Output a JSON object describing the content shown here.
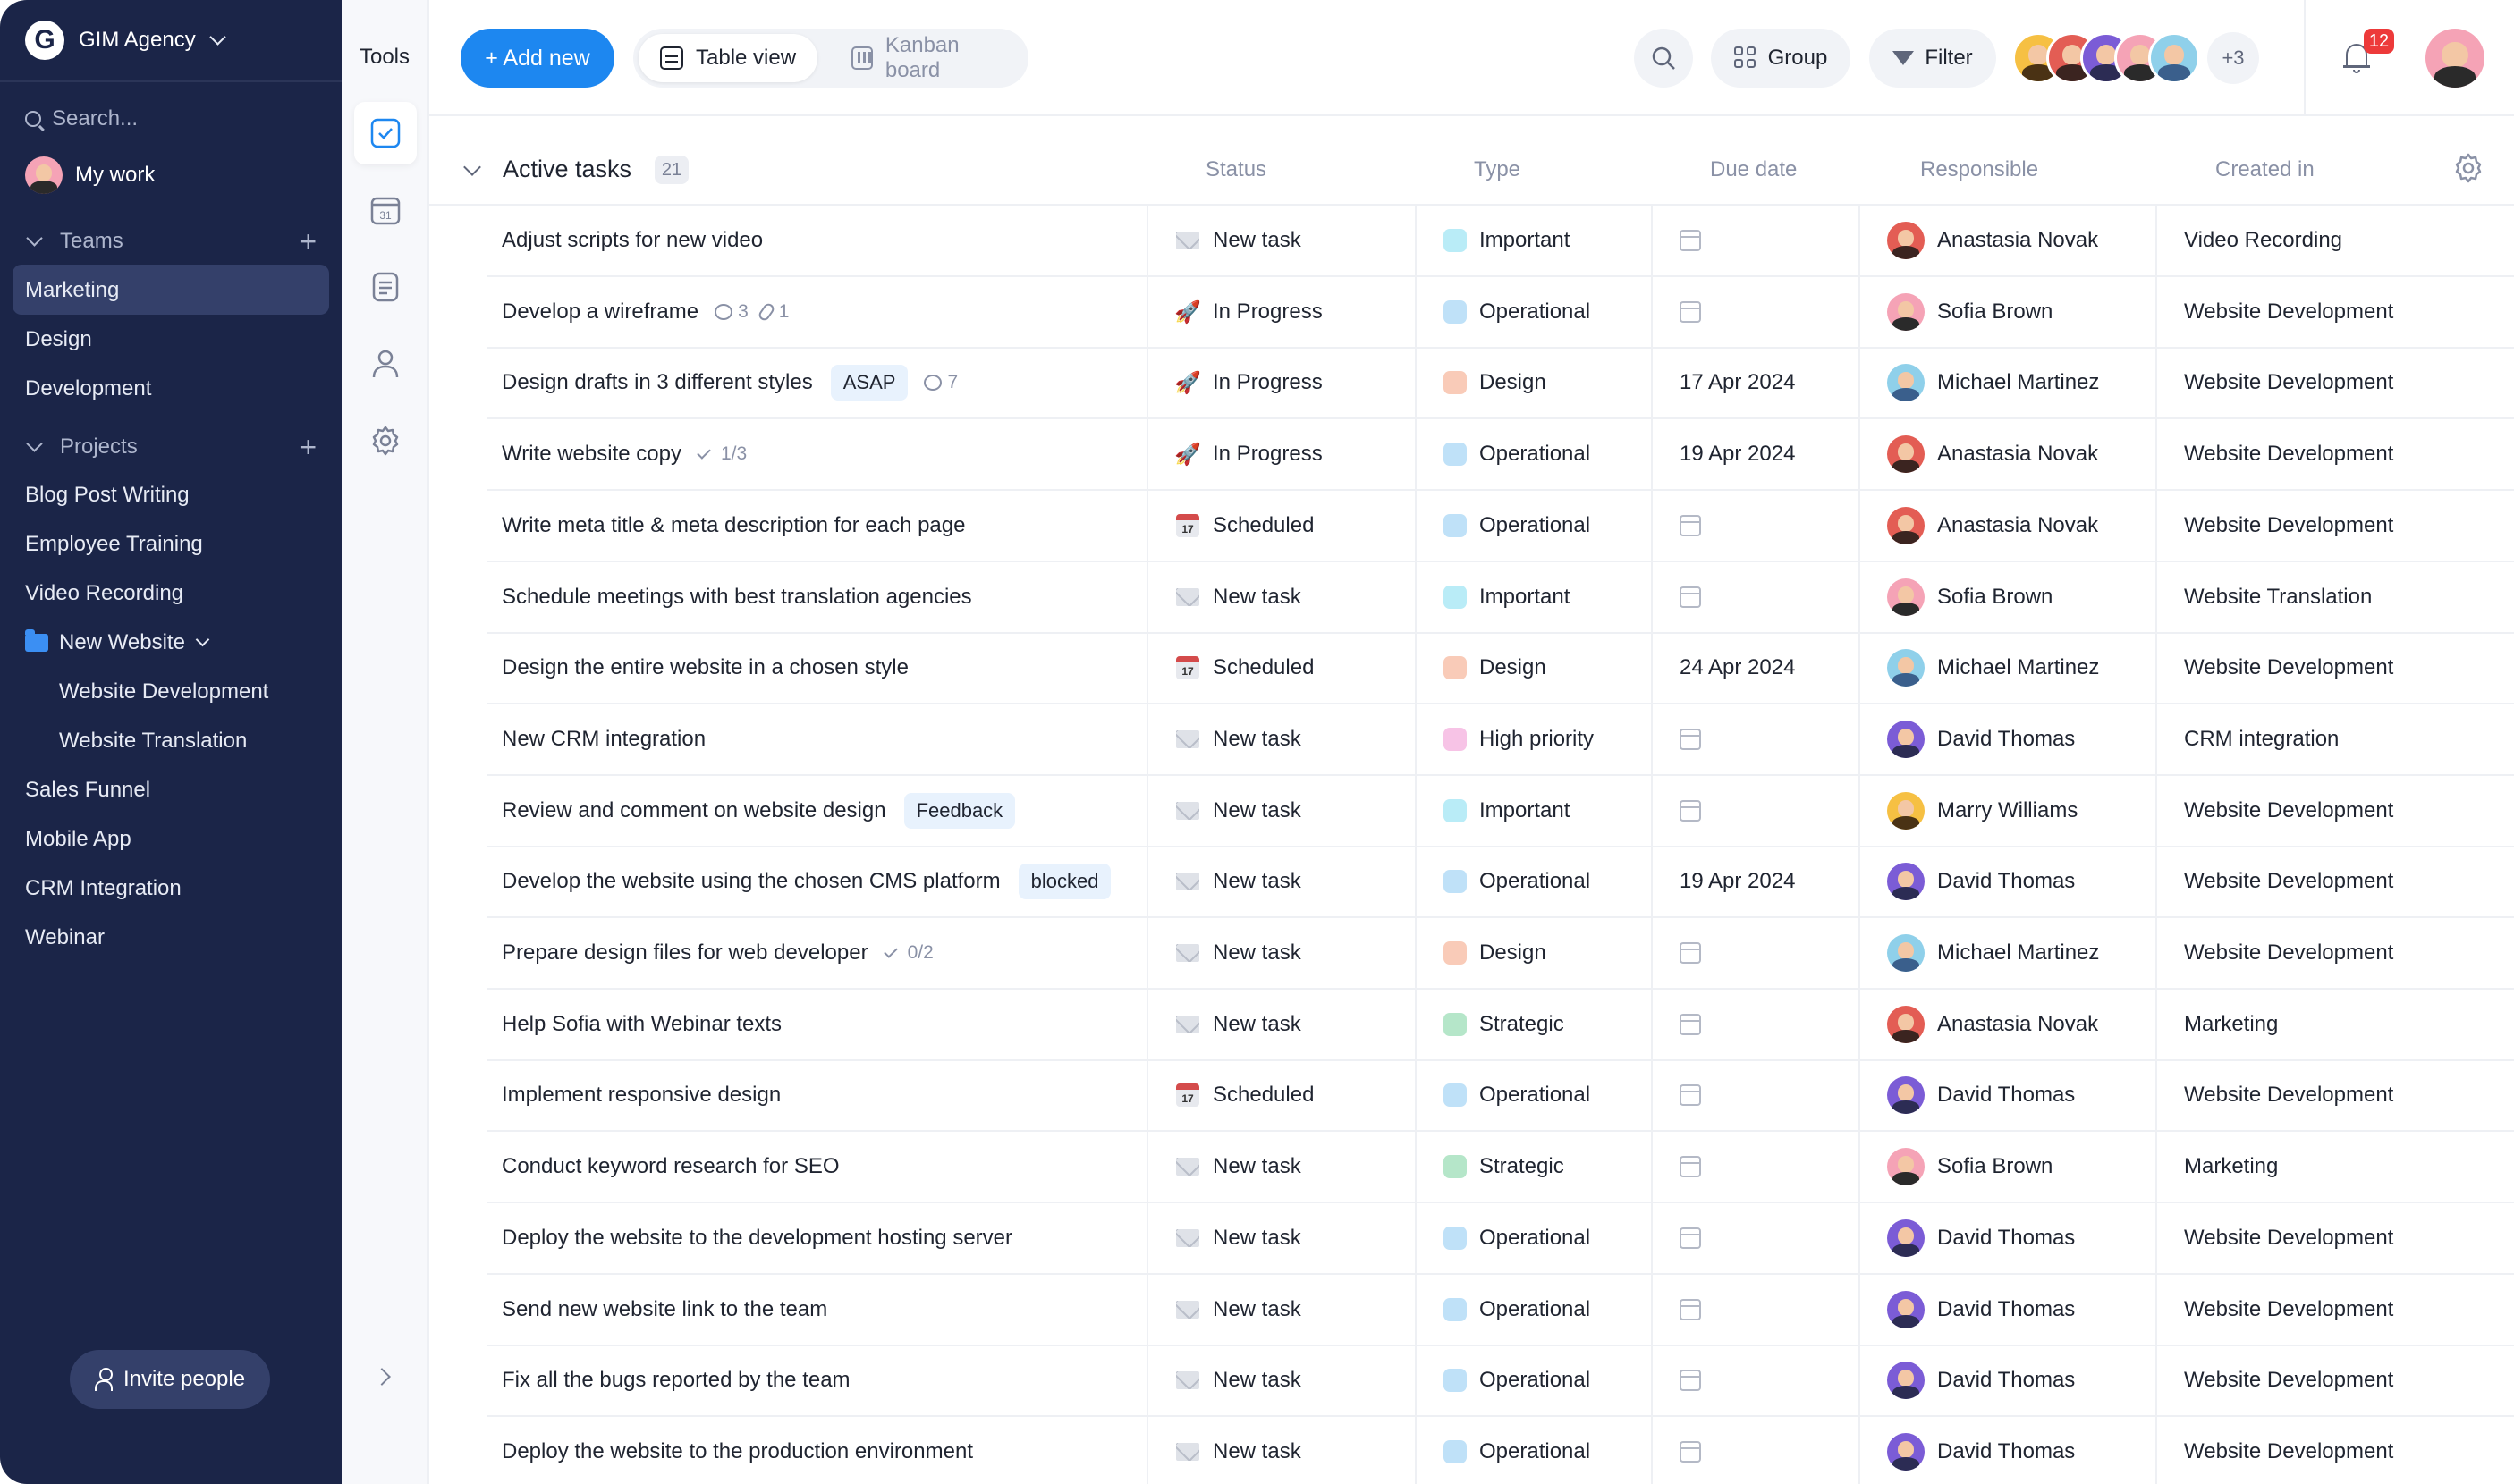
{
  "sidebar": {
    "workspace": "GIM Agency",
    "logo_letter": "G",
    "search_placeholder": "Search...",
    "my_work": "My work",
    "teams_label": "Teams",
    "teams": [
      "Marketing",
      "Design",
      "Development"
    ],
    "active_team": "Marketing",
    "projects_label": "Projects",
    "projects": [
      "Blog Post Writing",
      "Employee Training",
      "Video Recording"
    ],
    "folder": "New Website",
    "folder_children": [
      "Website Development",
      "Website Translation"
    ],
    "projects_after": [
      "Sales Funnel",
      "Mobile App",
      "CRM Integration",
      "Webinar"
    ],
    "invite": "Invite people"
  },
  "tools": {
    "title": "Tools",
    "calendar_day": "31"
  },
  "topbar": {
    "add_new": "+ Add new",
    "views": [
      "Table view",
      "Kanban board"
    ],
    "active_view": "Table view",
    "group": "Group",
    "filter": "Filter",
    "more_members": "+3",
    "notifications": "12"
  },
  "table": {
    "group_title": "Active tasks",
    "count": "21",
    "columns": [
      "Status",
      "Type",
      "Due date",
      "Responsible",
      "Created in"
    ],
    "rows": [
      {
        "task": "Adjust scripts for new video",
        "status": "New task",
        "status_icon": "envelope",
        "type": "Important",
        "type_color": "#b9ecf7",
        "due": "",
        "responsible": "Anastasia Novak",
        "avatar": "red",
        "created_in": "Video Recording"
      },
      {
        "task": "Develop a wireframe",
        "comments": "3",
        "attachments": "1",
        "status": "In Progress",
        "status_icon": "rocket",
        "type": "Operational",
        "type_color": "#bfe1f8",
        "due": "",
        "responsible": "Sofia Brown",
        "avatar": "pink",
        "created_in": "Website Development"
      },
      {
        "task": "Design drafts in 3 different styles",
        "tag": "ASAP",
        "comments": "7",
        "status": "In Progress",
        "status_icon": "rocket",
        "type": "Design",
        "type_color": "#f9cbb8",
        "due": "17 Apr 2024",
        "responsible": "Michael Martinez",
        "avatar": "blue",
        "created_in": "Website Development"
      },
      {
        "task": "Write website copy",
        "checklist": "1/3",
        "status": "In Progress",
        "status_icon": "rocket",
        "type": "Operational",
        "type_color": "#bfe1f8",
        "due": "19 Apr 2024",
        "responsible": "Anastasia Novak",
        "avatar": "red",
        "created_in": "Website Development"
      },
      {
        "task": "Write meta title & meta description for each page",
        "status": "Scheduled",
        "status_icon": "calendar",
        "type": "Operational",
        "type_color": "#bfe1f8",
        "due": "",
        "responsible": "Anastasia Novak",
        "avatar": "red",
        "created_in": "Website Development"
      },
      {
        "task": "Schedule meetings with best translation agencies",
        "status": "New task",
        "status_icon": "envelope",
        "type": "Important",
        "type_color": "#b9ecf7",
        "due": "",
        "responsible": "Sofia Brown",
        "avatar": "pink",
        "created_in": "Website Translation"
      },
      {
        "task": "Design the entire website in a chosen style",
        "status": "Scheduled",
        "status_icon": "calendar",
        "type": "Design",
        "type_color": "#f9cbb8",
        "due": "24 Apr 2024",
        "responsible": "Michael Martinez",
        "avatar": "blue",
        "created_in": "Website Development"
      },
      {
        "task": "New CRM integration",
        "status": "New task",
        "status_icon": "envelope",
        "type": "High priority",
        "type_color": "#f7c3e6",
        "due": "",
        "responsible": "David Thomas",
        "avatar": "purple",
        "created_in": "CRM integration"
      },
      {
        "task": "Review and comment on website design",
        "tag": "Feedback",
        "status": "New task",
        "status_icon": "envelope",
        "type": "Important",
        "type_color": "#b9ecf7",
        "due": "",
        "responsible": "Marry Williams",
        "avatar": "yellow",
        "created_in": "Website Development"
      },
      {
        "task": "Develop the website using the chosen CMS platform",
        "tag": "blocked",
        "status": "New task",
        "status_icon": "envelope",
        "type": "Operational",
        "type_color": "#bfe1f8",
        "due": "19 Apr 2024",
        "responsible": "David Thomas",
        "avatar": "purple",
        "created_in": "Website Development"
      },
      {
        "task": "Prepare design files for web developer",
        "checklist": "0/2",
        "status": "New task",
        "status_icon": "envelope",
        "type": "Design",
        "type_color": "#f9cbb8",
        "due": "",
        "responsible": "Michael Martinez",
        "avatar": "blue",
        "created_in": "Website Development"
      },
      {
        "task": "Help Sofia with Webinar texts",
        "status": "New task",
        "status_icon": "envelope",
        "type": "Strategic",
        "type_color": "#b5e6c9",
        "due": "",
        "responsible": "Anastasia Novak",
        "avatar": "red",
        "created_in": "Marketing"
      },
      {
        "task": "Implement responsive design",
        "status": "Scheduled",
        "status_icon": "calendar",
        "type": "Operational",
        "type_color": "#bfe1f8",
        "due": "",
        "responsible": "David Thomas",
        "avatar": "purple",
        "created_in": "Website Development"
      },
      {
        "task": "Conduct keyword research for SEO",
        "status": "New task",
        "status_icon": "envelope",
        "type": "Strategic",
        "type_color": "#b5e6c9",
        "due": "",
        "responsible": "Sofia Brown",
        "avatar": "pink",
        "created_in": "Marketing"
      },
      {
        "task": "Deploy the website to the development hosting server",
        "status": "New task",
        "status_icon": "envelope",
        "type": "Operational",
        "type_color": "#bfe1f8",
        "due": "",
        "responsible": "David Thomas",
        "avatar": "purple",
        "created_in": "Website Development"
      },
      {
        "task": "Send new website link to the team",
        "status": "New task",
        "status_icon": "envelope",
        "type": "Operational",
        "type_color": "#bfe1f8",
        "due": "",
        "responsible": "David Thomas",
        "avatar": "purple",
        "created_in": "Website Development"
      },
      {
        "task": "Fix all the bugs reported by the team",
        "status": "New task",
        "status_icon": "envelope",
        "type": "Operational",
        "type_color": "#bfe1f8",
        "due": "",
        "responsible": "David Thomas",
        "avatar": "purple",
        "created_in": "Website Development"
      },
      {
        "task": "Deploy the website to the production environment",
        "status": "New task",
        "status_icon": "envelope",
        "type": "Operational",
        "type_color": "#bfe1f8",
        "due": "",
        "responsible": "David Thomas",
        "avatar": "purple",
        "created_in": "Website Development"
      }
    ]
  }
}
